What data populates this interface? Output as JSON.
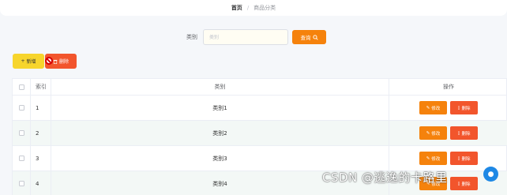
{
  "breadcrumb": {
    "home": "首页",
    "separator": "/",
    "current": "商品分类"
  },
  "search": {
    "label": "类别",
    "placeholder": "类别",
    "button_label": "查询",
    "button_icon": "search-icon"
  },
  "toolbar": {
    "add_label": "新增",
    "add_icon": "plus-icon",
    "delete_label": "删除",
    "delete_icon": "trash-icon"
  },
  "table": {
    "headers": {
      "index": "索引",
      "category": "类别",
      "ops": "操作"
    },
    "rows": [
      {
        "index": "1",
        "category": "类别1"
      },
      {
        "index": "2",
        "category": "类别2"
      },
      {
        "index": "3",
        "category": "类别3"
      },
      {
        "index": "4",
        "category": "类别4"
      }
    ],
    "edit_label": "修改",
    "delete_label": "删除"
  },
  "watermark": {
    "text": "CSDN @逃逸的卡路里"
  },
  "colors": {
    "accent": "#f5820c",
    "danger": "#f2552c",
    "warning": "#f7d52c",
    "stripe": "#f3f8f6"
  }
}
